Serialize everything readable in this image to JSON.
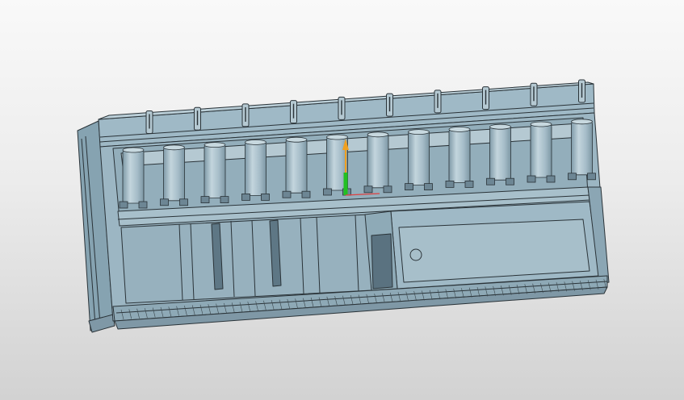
{
  "viewport": {
    "background_top": "#f9f9f9",
    "background_bottom": "#d2d2d2"
  },
  "model": {
    "part_color": "#9fb9c6",
    "part_shade": "#86a3b1",
    "part_light": "#bcd0d9",
    "edge_color": "#2a3338",
    "roller_count_upper": 12,
    "bracket_count_top": 10,
    "icon": "sheet-metal-roller-conveyor-assembly"
  },
  "triad": {
    "x_color": "#e04040",
    "y_color": "#22c022",
    "z_color": "#f0a020"
  }
}
